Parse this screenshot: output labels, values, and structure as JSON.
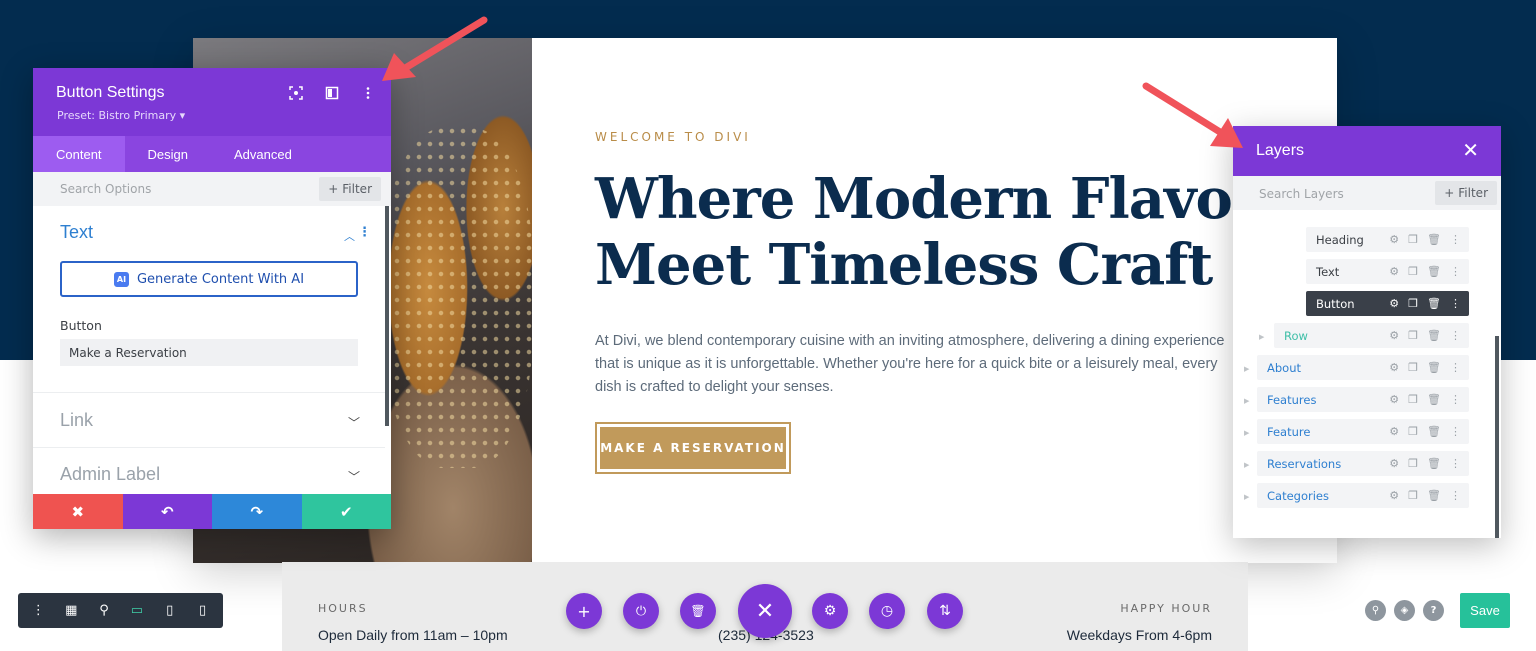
{
  "card": {
    "eyebrow": "WELCOME TO DIVI",
    "headline_line1": "Where Modern Flavors",
    "headline_line2": "Meet Timeless Craft",
    "body": "At Divi, we blend contemporary cuisine with an inviting atmosphere, delivering a dining experience that is unique as it is unforgettable. Whether you're here for a quick bite or a leisurely meal, every dish is crafted to delight your senses.",
    "cta": "MAKE A RESERVATION"
  },
  "footer": {
    "hours_label": "HOURS",
    "hours_value": "Open Daily from 11am – 10pm",
    "phone_value": "(235) 124-3523",
    "happy_label": "HAPPY HOUR",
    "happy_value": "Weekdays From 4-6pm"
  },
  "settings": {
    "title": "Button Settings",
    "preset": "Preset: Bistro Primary ▾",
    "tabs": [
      "Content",
      "Design",
      "Advanced"
    ],
    "active_tab": "Content",
    "search_placeholder": "Search Options",
    "filter_label": "Filter",
    "section_text": "Text",
    "ai_button": "Generate Content With AI",
    "ai_badge": "AI",
    "field_label": "Button",
    "field_value": "Make a Reservation",
    "section_link": "Link",
    "section_admin": "Admin Label",
    "icons": [
      "fullscreen-icon",
      "split-view-icon",
      "more-vertical-icon"
    ],
    "action_icons": [
      "discard-icon",
      "undo-icon",
      "redo-icon",
      "save-check-icon"
    ],
    "colors": {
      "header": "#7c38d6",
      "cancel": "#ef5350",
      "undo": "#7c38d6",
      "redo": "#2d88d9",
      "confirm": "#2fc59e"
    }
  },
  "layers": {
    "title": "Layers",
    "search_placeholder": "Search Layers",
    "filter_label": "Filter",
    "items": [
      {
        "label": "Heading",
        "kind": "module"
      },
      {
        "label": "Text",
        "kind": "module"
      },
      {
        "label": "Button",
        "kind": "module-active"
      },
      {
        "label": "Row",
        "kind": "row"
      },
      {
        "label": "About",
        "kind": "section"
      },
      {
        "label": "Features",
        "kind": "section"
      },
      {
        "label": "Feature",
        "kind": "section"
      },
      {
        "label": "Reservations",
        "kind": "section"
      },
      {
        "label": "Categories",
        "kind": "section"
      }
    ]
  },
  "toolbar": {
    "left_icons": [
      "more-vertical-icon",
      "wireframe-icon",
      "zoom-icon",
      "desktop-icon",
      "tablet-icon",
      "phone-icon"
    ],
    "center_icons": [
      "add-icon",
      "power-icon",
      "trash-icon",
      "close-icon",
      "gear-icon",
      "history-icon",
      "sort-icon"
    ],
    "right_icons": [
      "search-icon",
      "layers-icon",
      "help-icon"
    ],
    "save_label": "Save"
  }
}
